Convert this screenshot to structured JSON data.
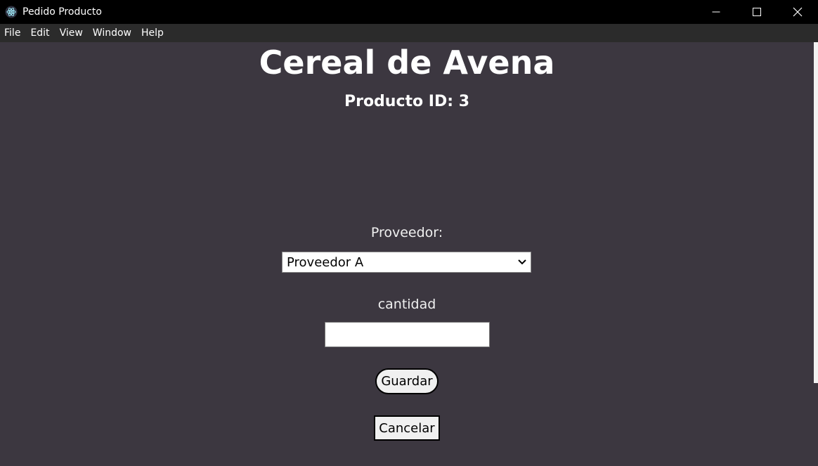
{
  "window": {
    "title": "Pedido Producto",
    "icon": "electron-app-icon",
    "controls": [
      "minimize-icon",
      "maximize-icon",
      "close-icon"
    ]
  },
  "menu": {
    "items": [
      "File",
      "Edit",
      "View",
      "Window",
      "Help"
    ]
  },
  "product": {
    "name": "Cereal de Avena",
    "id_label": "Producto ID: 3"
  },
  "form": {
    "supplier_label": "Proveedor:",
    "supplier_selected": "Proveedor A",
    "quantity_label": "cantidad",
    "quantity_value": "",
    "save_label": "Guardar",
    "cancel_label": "Cancelar"
  },
  "colors": {
    "background": "#3c3740",
    "titlebar": "#000000",
    "menubar": "#2b2b2b"
  }
}
